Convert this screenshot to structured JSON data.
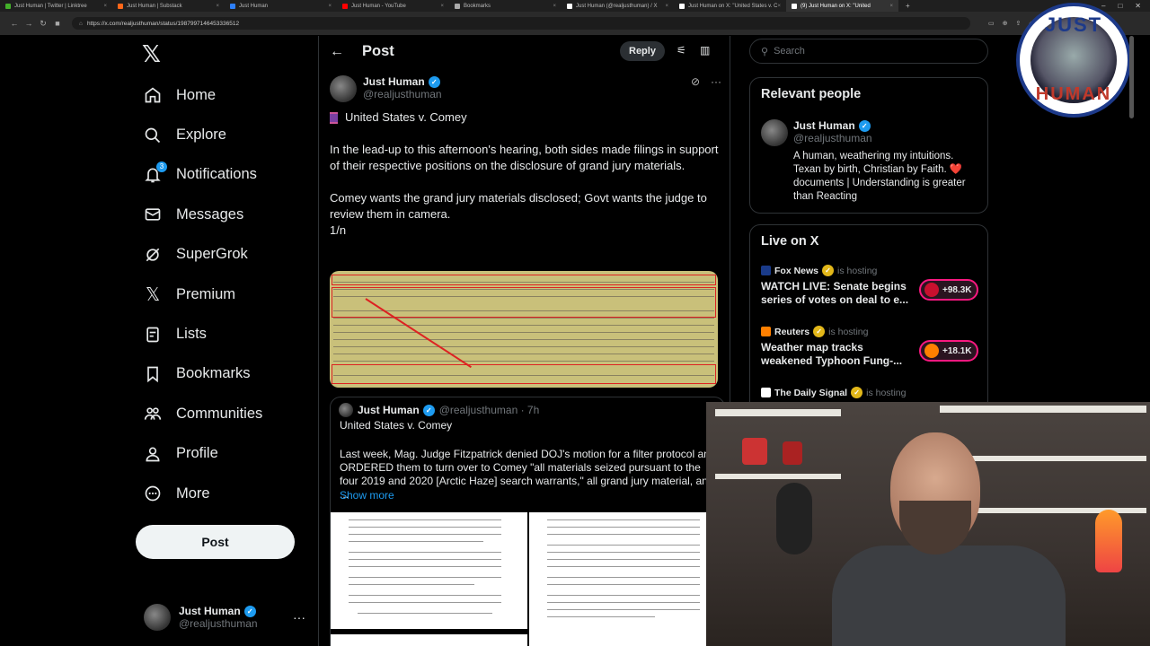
{
  "browser": {
    "tabs": [
      {
        "label": "Just Human | Twitter | Linktree",
        "color": "#43b02a"
      },
      {
        "label": "Just Human | Substack",
        "color": "#ff6719"
      },
      {
        "label": "Just Human",
        "color": "#2d7ff9"
      },
      {
        "label": "Just Human - YouTube",
        "color": "#ff0000"
      },
      {
        "label": "Bookmarks",
        "color": "#aaaaaa"
      },
      {
        "label": "Just Human (@realjusthuman) / X",
        "color": "#ffffff"
      },
      {
        "label": "Just Human on X: \"United States v. C",
        "color": "#ffffff"
      },
      {
        "label": "(9) Just Human on X: \"United",
        "color": "#ffffff",
        "active": true
      }
    ],
    "url": "https://x.com/realjusthuman/status/1987997146453336512"
  },
  "nav": {
    "items": [
      {
        "label": "Home",
        "icon": "home-icon",
        "name": "nav-home"
      },
      {
        "label": "Explore",
        "icon": "search-icon",
        "name": "nav-explore"
      },
      {
        "label": "Notifications",
        "icon": "bell-icon",
        "name": "nav-notifications"
      },
      {
        "label": "Messages",
        "icon": "envelope-icon",
        "name": "nav-messages"
      },
      {
        "label": "SuperGrok",
        "icon": "grok-icon",
        "name": "nav-supergrok"
      },
      {
        "label": "Premium",
        "icon": "x-icon",
        "name": "nav-premium"
      },
      {
        "label": "Lists",
        "icon": "list-icon",
        "name": "nav-lists"
      },
      {
        "label": "Bookmarks",
        "icon": "bookmark-icon",
        "name": "nav-bookmarks"
      },
      {
        "label": "Communities",
        "icon": "people-icon",
        "name": "nav-communities"
      },
      {
        "label": "Profile",
        "icon": "person-icon",
        "name": "nav-profile"
      },
      {
        "label": "More",
        "icon": "more-circle-icon",
        "name": "nav-more"
      }
    ],
    "notification_count": "3",
    "post_label": "Post",
    "account": {
      "name": "Just Human",
      "handle": "@realjusthuman"
    }
  },
  "main": {
    "title": "Post",
    "reply_label": "Reply",
    "tweet": {
      "name": "Just Human",
      "handle": "@realjusthuman",
      "title": "United States v. Comey",
      "para1": "In the lead-up to this afternoon's hearing, both sides made filings in support of their respective positions on the disclosure of grand jury materials.",
      "para2": "Comey wants the grand jury materials disclosed; Govt wants the judge to review them in camera.",
      "para3": "1/n"
    },
    "quote": {
      "name": "Just Human",
      "handle": "@realjusthuman · 7h",
      "title": "United States v. Comey",
      "body": "Last week, Mag. Judge Fitzpatrick denied DOJ's motion for a filter protocol and ORDERED them to turn over to Comey \"all materials seized pursuant to the four 2019 and 2020 [Arctic Haze] search warrants,\" all grand jury material, and ...",
      "show_more": "Show more"
    }
  },
  "right": {
    "search_placeholder": "Search",
    "relevant": {
      "heading": "Relevant people",
      "name": "Just Human",
      "handle": "@realjusthuman",
      "bio": "A human, weathering my intuitions. Texan by birth, Christian by Faith. ❤️ documents | Understanding is greater than Reacting"
    },
    "live": {
      "heading": "Live on X",
      "items": [
        {
          "source": "Fox News",
          "hosting": "is hosting",
          "title": "WATCH LIVE: Senate begins series of votes on deal to e...",
          "count": "+98.3K",
          "color": "#c8102e"
        },
        {
          "source": "Reuters",
          "hosting": "is hosting",
          "title": "Weather map tracks weakened Typhoon Fung-...",
          "count": "+18.1K",
          "color": "#ff8000"
        },
        {
          "source": "The Daily Signal",
          "hosting": "is hosting",
          "title": "",
          "count": "",
          "color": "#ffffff"
        }
      ]
    }
  },
  "logo": {
    "top": "JUST",
    "bottom": "HUMAN"
  }
}
